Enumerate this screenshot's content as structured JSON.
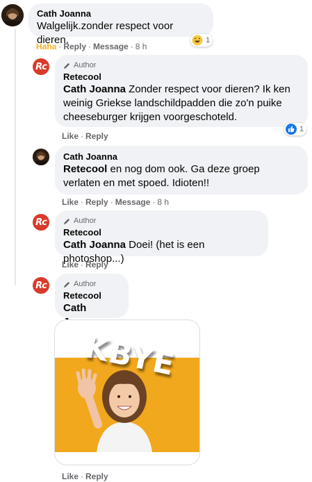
{
  "comments": [
    {
      "name": "Cath Joanna",
      "text": "Walgelijk.zonder respect voor dieren.",
      "actions": {
        "reaction": "Haha",
        "reply": "Reply",
        "message": "Message",
        "time": "8 h"
      },
      "reaction_count": "1",
      "reaction_icon": "haha-emoji-icon"
    },
    {
      "author_badge": "Author",
      "name": "Retecool",
      "mention": "Cath Joanna",
      "text": " Zonder respect voor dieren? Ik ken weinig Griekse landschildpadden die zo'n puike cheeseburger krijgen voorgeschoteld.",
      "actions": {
        "like": "Like",
        "reply": "Reply"
      },
      "reaction_count": "1",
      "reaction_icon": "like-thumb-icon"
    },
    {
      "name": "Cath Joanna",
      "mention": "Retecool",
      "text": " en nog dom ook. Ga deze groep verlaten en met spoed. Idioten!!",
      "actions": {
        "like": "Like",
        "reply": "Reply",
        "message": "Message",
        "time": "8 h"
      }
    },
    {
      "author_badge": "Author",
      "name": "Retecool",
      "mention": "Cath Joanna",
      "text": " Doei! (het is een photoshop...)",
      "actions": {
        "like": "Like",
        "reply": "Reply"
      }
    },
    {
      "author_badge": "Author",
      "name": "Retecool",
      "mention": "Cath Joanna",
      "image_text": "KBYE",
      "actions": {
        "like": "Like",
        "reply": "Reply"
      }
    }
  ],
  "brand": {
    "avatar_text": "Rc",
    "color": "#d93a2b"
  },
  "colors": {
    "bubble": "#f0f2f5",
    "meta": "#65676b",
    "haha": "#f7b125",
    "like_blue": "#1877f2",
    "image_bg": "#f2a81d"
  }
}
